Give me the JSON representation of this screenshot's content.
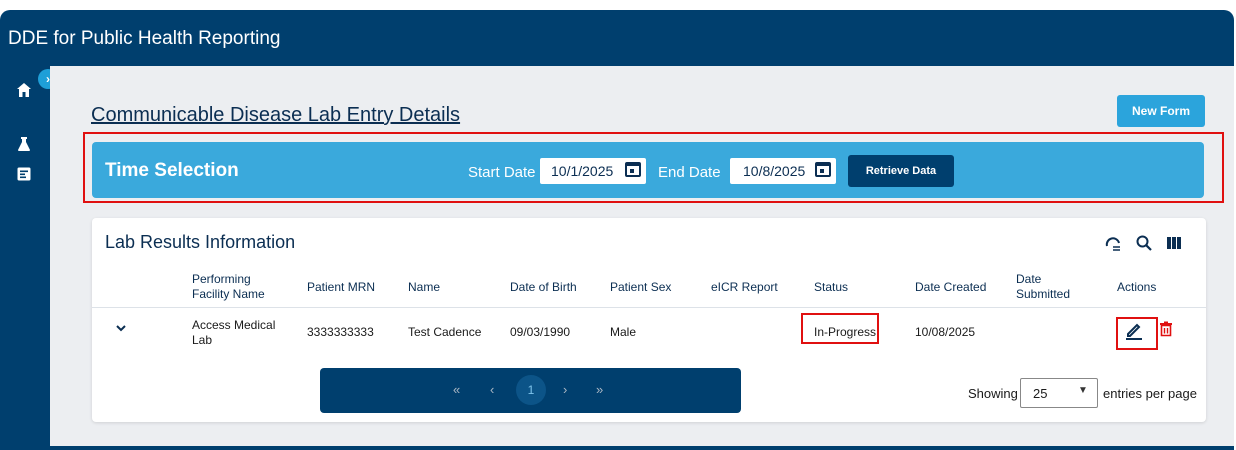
{
  "app": {
    "title": "DDE for Public Health Reporting"
  },
  "page": {
    "title": "Communicable Disease Lab Entry Details",
    "new_form_label": "New Form"
  },
  "time_selection": {
    "title": "Time Selection",
    "start_label": "Start Date",
    "start_value": "10/1/2025",
    "end_label": "End Date",
    "end_value": "10/8/2025",
    "retrieve_label": "Retrieve Data"
  },
  "lab_results": {
    "title": "Lab Results Information",
    "columns": [
      "Performing Facility Name",
      "Patient MRN",
      "Name",
      "Date of Birth",
      "Patient Sex",
      "eICR Report",
      "Status",
      "Date Created",
      "Date Submitted",
      "Actions"
    ],
    "rows": [
      {
        "facility": "Access Medical Lab",
        "mrn": "3333333333",
        "name": "Test Cadence",
        "dob": "09/03/1990",
        "sex": "Male",
        "eicr": "",
        "status": "In-Progress",
        "date_created": "10/08/2025",
        "date_submitted": ""
      }
    ]
  },
  "pagination": {
    "first": "«",
    "prev": "‹",
    "current": "1",
    "next": "›",
    "last": "»",
    "showing_label": "Showing",
    "page_size": "25",
    "entries_label": "entries per page"
  },
  "colors": {
    "navy": "#003f6e",
    "accent": "#2ba4dc",
    "highlight": "#e01010",
    "delete": "#e01010"
  }
}
